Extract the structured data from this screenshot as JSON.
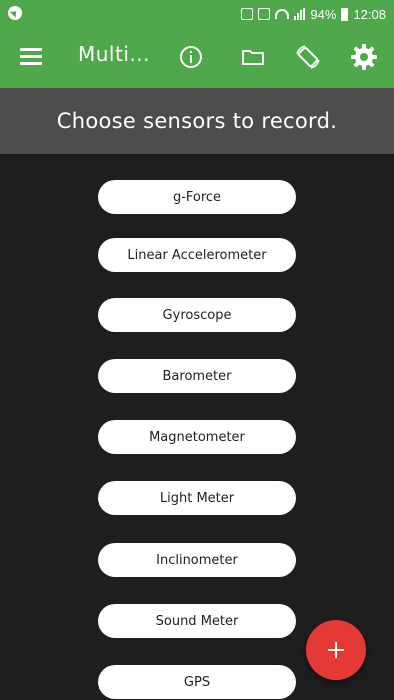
{
  "status_bar": {
    "battery_percent": "94%",
    "time": "12:08",
    "icons": [
      "navigation-icon",
      "alarm-icon",
      "wifi-icon",
      "signal-icon",
      "battery-icon"
    ]
  },
  "app_bar": {
    "title": "Multi...",
    "icons": [
      "menu-icon",
      "info-icon",
      "folder-icon",
      "screen-rotation-icon",
      "settings-icon"
    ]
  },
  "header": {
    "text": "Choose sensors to record."
  },
  "sensors": [
    {
      "label": "g-Force"
    },
    {
      "label": "Linear Accelerometer"
    },
    {
      "label": "Gyroscope"
    },
    {
      "label": "Barometer"
    },
    {
      "label": "Magnetometer"
    },
    {
      "label": "Light Meter"
    },
    {
      "label": "Inclinometer"
    },
    {
      "label": "Sound Meter"
    },
    {
      "label": "GPS"
    }
  ],
  "fab": {
    "icon": "plus-icon"
  },
  "colors": {
    "primary": "#4fa84b",
    "header_background": "#4c4c4c",
    "background": "#1e1e1e",
    "fab": "#e53935",
    "button": "#ffffff"
  }
}
